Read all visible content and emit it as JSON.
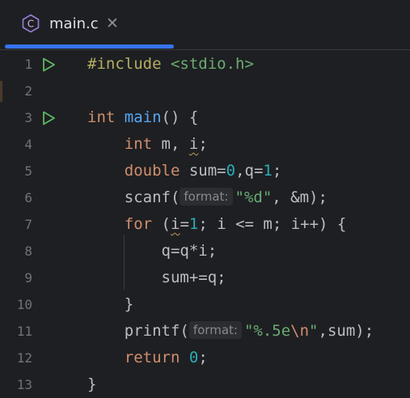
{
  "tab": {
    "filename": "main.c",
    "file_icon": "c-file-icon",
    "close_icon": "close-icon",
    "close_glyph": "✕"
  },
  "editor": {
    "lines": [
      {
        "number": "1",
        "has_run_icon": true,
        "tokens": [
          {
            "t": "#include ",
            "c": "pre"
          },
          {
            "t": "<stdio.h>",
            "c": "inc"
          }
        ]
      },
      {
        "number": "2",
        "has_run_icon": false,
        "tokens": []
      },
      {
        "number": "3",
        "has_run_icon": true,
        "tokens": [
          {
            "t": "int",
            "c": "kw"
          },
          {
            "t": " "
          },
          {
            "t": "main",
            "c": "fn"
          },
          {
            "t": "() {"
          }
        ]
      },
      {
        "number": "4",
        "has_run_icon": false,
        "tokens": [
          {
            "t": "    "
          },
          {
            "t": "int",
            "c": "kw"
          },
          {
            "t": " m, "
          },
          {
            "t": "i",
            "c": "squig"
          },
          {
            "t": ";"
          }
        ]
      },
      {
        "number": "5",
        "has_run_icon": false,
        "tokens": [
          {
            "t": "    "
          },
          {
            "t": "double",
            "c": "kw"
          },
          {
            "t": " sum="
          },
          {
            "t": "0",
            "c": "num"
          },
          {
            "t": ",q="
          },
          {
            "t": "1",
            "c": "num"
          },
          {
            "t": ";"
          }
        ]
      },
      {
        "number": "6",
        "has_run_icon": false,
        "tokens": [
          {
            "t": "    scanf("
          },
          {
            "t": "format:",
            "c": "hint"
          },
          {
            "t": "\"%d\"",
            "c": "str"
          },
          {
            "t": ", &m);"
          }
        ]
      },
      {
        "number": "7",
        "has_run_icon": false,
        "tokens": [
          {
            "t": "    "
          },
          {
            "t": "for",
            "c": "kw"
          },
          {
            "t": " ("
          },
          {
            "t": "i",
            "c": "squig"
          },
          {
            "t": "="
          },
          {
            "t": "1",
            "c": "num"
          },
          {
            "t": "; i <= m; i++) {"
          }
        ]
      },
      {
        "number": "8",
        "has_run_icon": false,
        "tokens": [
          {
            "t": "        q=q*i;"
          }
        ]
      },
      {
        "number": "9",
        "has_run_icon": false,
        "tokens": [
          {
            "t": "        sum+=q;"
          }
        ]
      },
      {
        "number": "10",
        "has_run_icon": false,
        "tokens": [
          {
            "t": "    }"
          }
        ]
      },
      {
        "number": "11",
        "has_run_icon": false,
        "tokens": [
          {
            "t": "    printf("
          },
          {
            "t": "format:",
            "c": "hint"
          },
          {
            "t": "\"%.5e",
            "c": "str"
          },
          {
            "t": "\\n",
            "c": "esc"
          },
          {
            "t": "\"",
            "c": "str"
          },
          {
            "t": ",sum);"
          }
        ]
      },
      {
        "number": "12",
        "has_run_icon": false,
        "tokens": [
          {
            "t": "    "
          },
          {
            "t": "return",
            "c": "kw"
          },
          {
            "t": " "
          },
          {
            "t": "0",
            "c": "num"
          },
          {
            "t": ";"
          }
        ]
      },
      {
        "number": "13",
        "has_run_icon": false,
        "tokens": [
          {
            "t": "}"
          }
        ]
      }
    ]
  },
  "colors": {
    "background": "#1e1f22",
    "accent": "#3574f0",
    "keyword": "#cf8e6d",
    "function": "#56a8f5",
    "string": "#6aab73",
    "number": "#2aacb8",
    "run_icon": "#5fb865",
    "c_icon": "#9a7ed8"
  }
}
